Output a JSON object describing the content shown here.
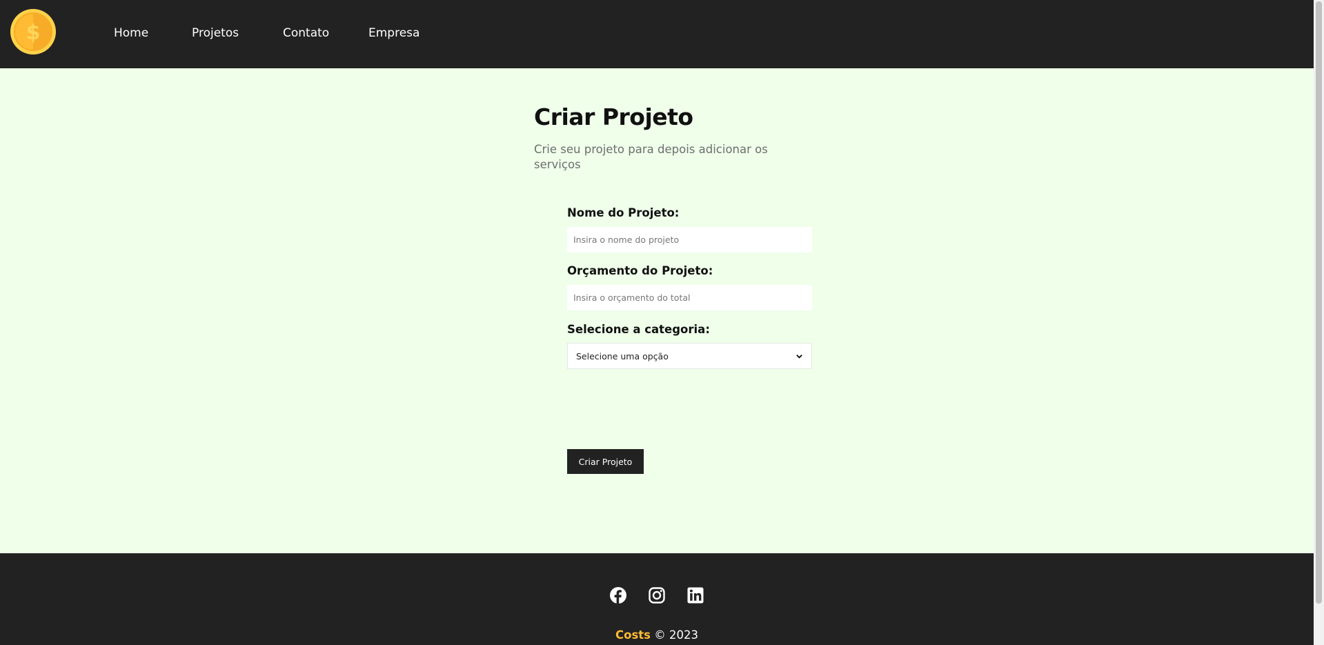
{
  "navbar": {
    "logo_icon": "coin-dollar-icon",
    "items": [
      {
        "label": "Home"
      },
      {
        "label": "Projetos"
      },
      {
        "label": "Contato"
      },
      {
        "label": "Empresa"
      }
    ]
  },
  "page": {
    "title": "Criar Projeto",
    "subtitle": "Crie seu projeto para depois adicionar os serviços"
  },
  "form": {
    "name_label": "Nome do Projeto:",
    "name_placeholder": "Insira o nome do projeto",
    "name_value": "",
    "budget_label": "Orçamento do Projeto:",
    "budget_placeholder": "Insira o orçamento do total",
    "budget_value": "",
    "category_label": "Selecione a categoria:",
    "category_selected": "Selecione uma opção",
    "submit_label": "Criar Projeto"
  },
  "footer": {
    "social_icons": [
      "facebook-icon",
      "instagram-icon",
      "linkedin-icon"
    ],
    "brand": "Costs",
    "copyright": " © 2023"
  },
  "colors": {
    "nav_background": "#222222",
    "page_background": "#efffea",
    "brand_accent": "#ffbb33",
    "coin_gold": "#ffbb33"
  }
}
